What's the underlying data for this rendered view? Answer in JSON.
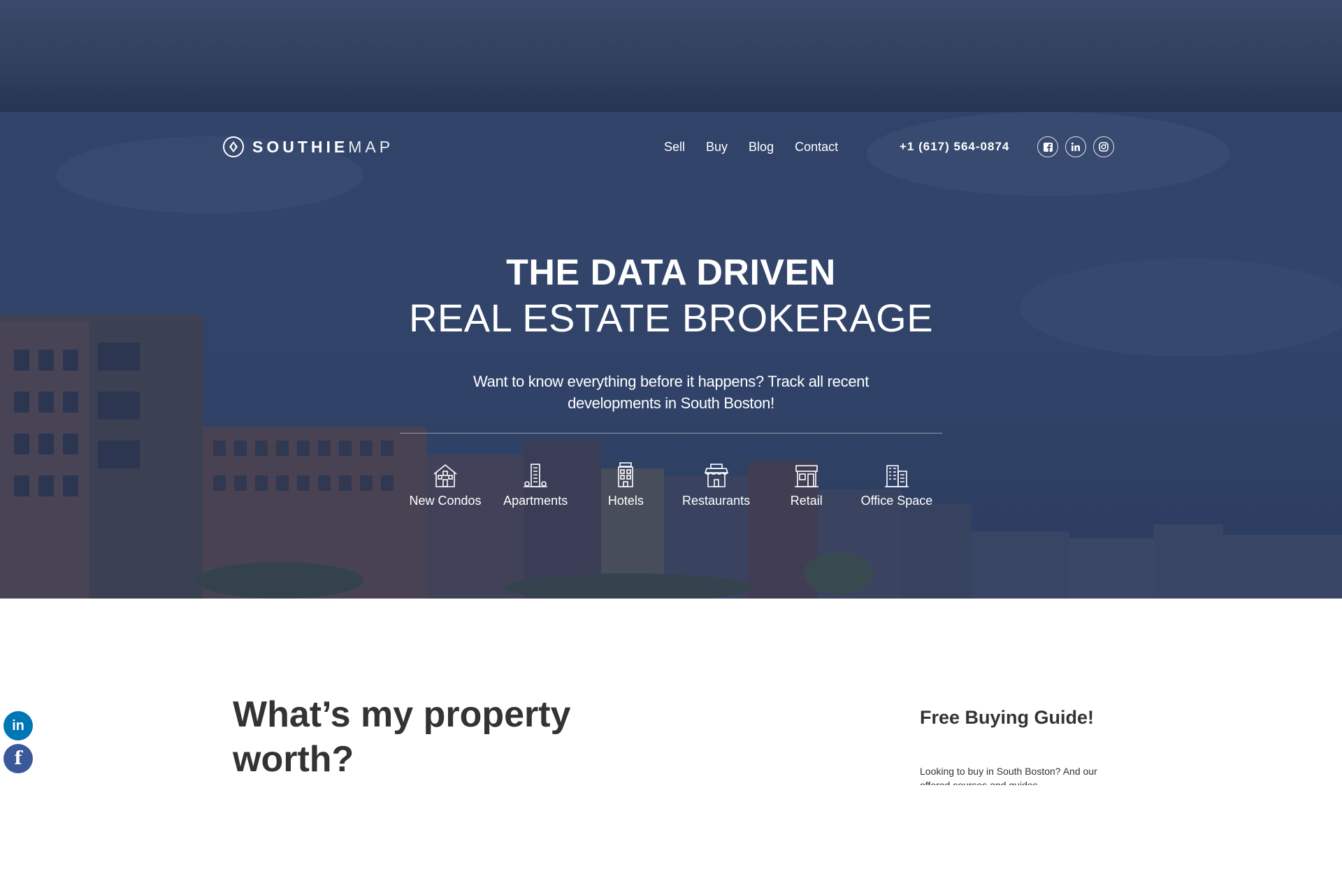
{
  "brand": {
    "name_bold": "SOUTHIE",
    "name_light": "MAP"
  },
  "nav": {
    "items": [
      "Sell",
      "Buy",
      "Blog",
      "Contact"
    ]
  },
  "header": {
    "phone": "+1 (617) 564-0874"
  },
  "hero": {
    "title_line1": "THE DATA DRIVEN",
    "title_line2": "REAL ESTATE BROKERAGE",
    "subtitle": "Want to know everything before it happens? Track all recent developments in South Boston!",
    "categories": [
      {
        "label": "New Condos",
        "icon": "house-icon"
      },
      {
        "label": "Apartments",
        "icon": "apartment-building-icon"
      },
      {
        "label": "Hotels",
        "icon": "hotel-icon"
      },
      {
        "label": "Restaurants",
        "icon": "restaurant-icon"
      },
      {
        "label": "Retail",
        "icon": "shop-icon"
      },
      {
        "label": "Office Space",
        "icon": "office-building-icon"
      }
    ]
  },
  "social_icons": [
    "facebook-icon",
    "linkedin-icon",
    "instagram-icon"
  ],
  "share": {
    "linkedin_glyph": "in",
    "facebook_glyph": "f"
  },
  "main": {
    "title": "What’s my property worth?",
    "guide": {
      "title": "Free Buying Guide!",
      "text": "Looking to buy in South Boston? And our offered courses and guides"
    }
  },
  "colors": {
    "hero_overlay": "#2c3c62",
    "heading_text": "#333333",
    "linkedin_blue": "#0077b5",
    "facebook_blue": "#3b5998"
  }
}
